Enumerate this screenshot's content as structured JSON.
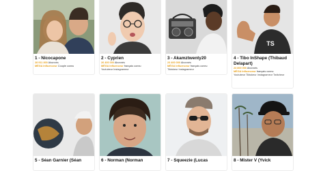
{
  "cards": [
    {
      "name": "1 - Nicocapone",
      "followers": "28 911 800",
      "followers_label": "Abonnés",
      "tier": "MÉGA Influenceur",
      "category": "Couple connu",
      "platforms": ""
    },
    {
      "name": "2 - Cyprien",
      "followers": "26 400 000",
      "followers_label": "Abonnés",
      "tier": "MÉGA Influenceur",
      "category": "français connu",
      "platforms": "Youtubeur Instagrameur"
    },
    {
      "name": "3 - Akamztwenty20",
      "followers": "23 400 000",
      "followers_label": "Abonnés",
      "tier": "MÉGA Influenceur",
      "category": "français connu",
      "platforms": "Tiktokeur Instagrameur"
    },
    {
      "name": "4 - Tibo InShape (Thibaud Delapart)",
      "followers": "23 800 000",
      "followers_label": "Abonnés",
      "tier": "MÉGA Influenceur",
      "category": "français connu",
      "platforms": "Youtubeur Tiktokeur Instagrameur Twitcheur"
    },
    {
      "name": "5 - Séan Garnier (Séan",
      "followers": "",
      "followers_label": "",
      "tier": "",
      "category": "",
      "platforms": ""
    },
    {
      "name": "6 - Norman (Norman",
      "followers": "",
      "followers_label": "",
      "tier": "",
      "category": "",
      "platforms": ""
    },
    {
      "name": "7 - Squeezie (Lucas",
      "followers": "",
      "followers_label": "",
      "tier": "",
      "category": "",
      "platforms": ""
    },
    {
      "name": "8 - Mister V (Yvick",
      "followers": "",
      "followers_label": "",
      "tier": "",
      "category": "",
      "platforms": ""
    }
  ]
}
